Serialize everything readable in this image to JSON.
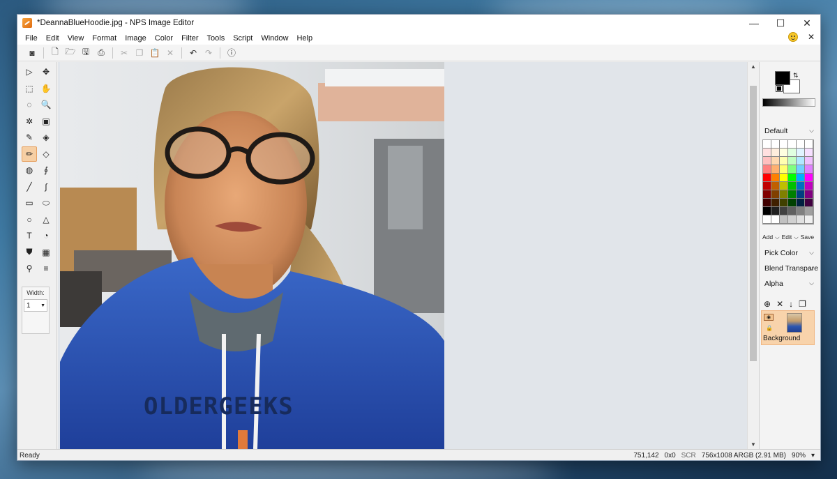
{
  "window": {
    "title": "*DeannaBlueHoodie.jpg - NPS Image Editor",
    "controls": {
      "minimize": "—",
      "maximize": "☐",
      "close": "✕"
    }
  },
  "menu": [
    "File",
    "Edit",
    "View",
    "Format",
    "Image",
    "Color",
    "Filter",
    "Tools",
    "Script",
    "Window",
    "Help"
  ],
  "toolbar": {
    "icons": [
      "screen-capture-icon",
      "new-file-icon",
      "open-folder-icon",
      "save-icon",
      "print-icon",
      "cut-icon",
      "copy-icon",
      "paste-icon",
      "delete-icon",
      "undo-icon",
      "redo-icon",
      "help-icon"
    ]
  },
  "tools": {
    "width_label": "Width:",
    "width_value": "1",
    "active": "pencil"
  },
  "canvas": {
    "image_text": "OLDERGEEKS"
  },
  "colors": {
    "foreground": "#000000",
    "background": "#ffffff",
    "palette_name": "Default",
    "palette": [
      "#ffffff",
      "#ffffff",
      "#ffffff",
      "#ffffff",
      "#ffffff",
      "#ffffff",
      "#ffe0e0",
      "#ffeedd",
      "#ffffe0",
      "#e0ffe0",
      "#e0f4ff",
      "#f6e0ff",
      "#ffc0c0",
      "#ffd8b0",
      "#ffffb0",
      "#c0ffc0",
      "#b0e8ff",
      "#f0c0ff",
      "#ff8080",
      "#ffb070",
      "#ffff70",
      "#80ff80",
      "#70d0ff",
      "#e080ff",
      "#ff0000",
      "#ff8000",
      "#ffff00",
      "#00ff00",
      "#00b0ff",
      "#ff00ff",
      "#c00000",
      "#c06000",
      "#c0c000",
      "#00c000",
      "#0070c0",
      "#c000c0",
      "#800000",
      "#804000",
      "#808000",
      "#008000",
      "#004080",
      "#800080",
      "#400000",
      "#402000",
      "#404000",
      "#004000",
      "#002040",
      "#400040",
      "#000000",
      "#202020",
      "#404040",
      "#606060",
      "#808080",
      "#a0a0a0",
      "#ffffff",
      "#ffffff",
      "#c0c0c0",
      "#d0d0d0",
      "#e0e0e0",
      "#f0f0f0"
    ],
    "palette_actions": {
      "add": "Add",
      "edit": "Edit",
      "save": "Save"
    },
    "pick_color": "Pick Color",
    "blend": "Blend Transpare",
    "alpha": "Alpha"
  },
  "layers": [
    {
      "name": "Background"
    }
  ],
  "status": {
    "ready": "Ready",
    "coords": "751,142",
    "size": "0x0",
    "scr": "SCR",
    "image_info": "756x1008 ARGB (2.91 MB)",
    "zoom": "90%"
  }
}
